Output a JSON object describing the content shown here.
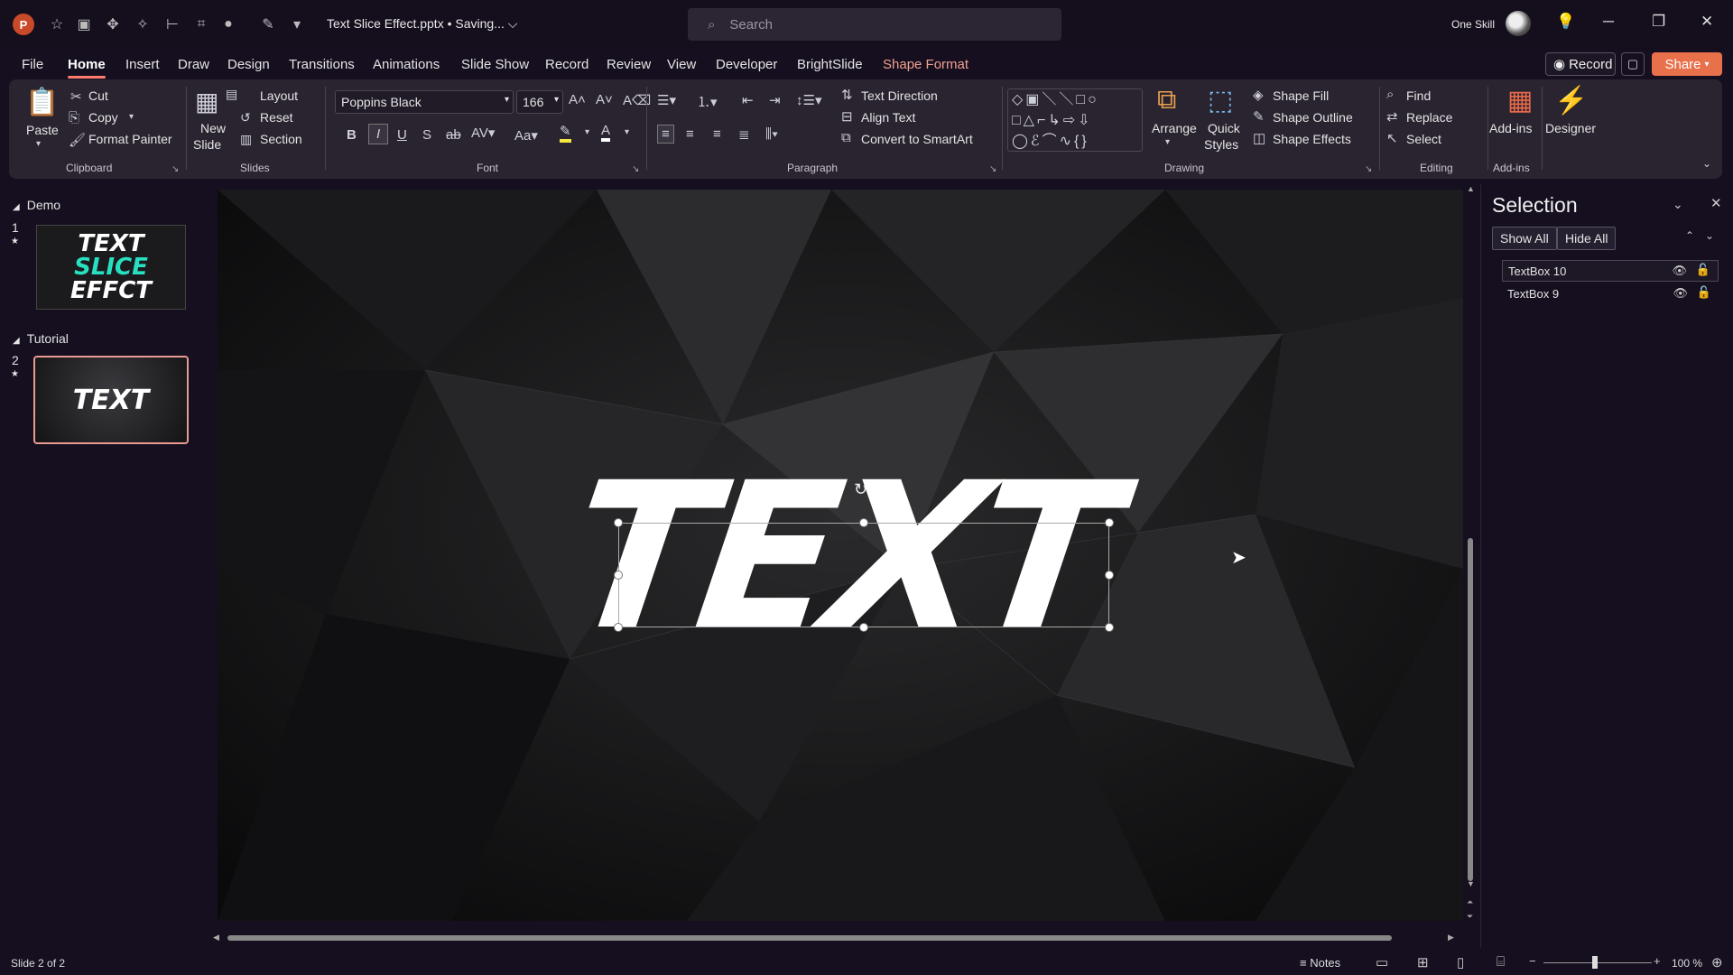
{
  "titlebar": {
    "doc_title": "Text Slice Effect.pptx • Saving... ⌵",
    "search_placeholder": "Search",
    "user_name": "One Skill"
  },
  "menu": {
    "tabs": [
      "File",
      "Home",
      "Insert",
      "Draw",
      "Design",
      "Transitions",
      "Animations",
      "Slide Show",
      "Record",
      "Review",
      "View",
      "Developer",
      "BrightSlide",
      "Shape Format"
    ],
    "active": "Home",
    "record_label": "Record",
    "share_label": "Share"
  },
  "ribbon": {
    "clipboard": {
      "paste": "Paste",
      "cut": "Cut",
      "copy": "Copy",
      "format_painter": "Format Painter",
      "label": "Clipboard"
    },
    "slides": {
      "new_slide_1": "New",
      "new_slide_2": "Slide",
      "layout": "Layout",
      "reset": "Reset",
      "section": "Section",
      "label": "Slides"
    },
    "font": {
      "family": "Poppins Black",
      "size": "166",
      "label": "Font"
    },
    "paragraph": {
      "text_direction": "Text Direction",
      "align_text": "Align Text",
      "convert_smartart": "Convert to SmartArt",
      "label": "Paragraph"
    },
    "drawing": {
      "arrange": "Arrange",
      "quick_styles_1": "Quick",
      "quick_styles_2": "Styles",
      "shape_fill": "Shape Fill",
      "shape_outline": "Shape Outline",
      "shape_effects": "Shape Effects",
      "label": "Drawing"
    },
    "editing": {
      "find": "Find",
      "replace": "Replace",
      "select": "Select",
      "label": "Editing"
    },
    "addins": {
      "addins": "Add-ins",
      "designer": "Designer",
      "label": "Add-ins"
    }
  },
  "left_panel": {
    "sections": [
      "Demo",
      "Tutorial"
    ],
    "slides": [
      {
        "number": "1",
        "lines": [
          "TEXT",
          "SLICE",
          "EFFCT"
        ]
      },
      {
        "number": "2",
        "lines": [
          "TEXT"
        ]
      }
    ]
  },
  "slide": {
    "text": "TEXT"
  },
  "selection_pane": {
    "title": "Selection",
    "show_all": "Show All",
    "hide_all": "Hide All",
    "items": [
      "TextBox 10",
      "TextBox 9"
    ]
  },
  "statusbar": {
    "slide_of": "Slide 2 of 2",
    "notes": "Notes",
    "zoom": "100 %"
  },
  "colors": {
    "accent": "#ff7b6b",
    "shape_format": "#f0a08e",
    "share": "#e8704a",
    "slide_thumb_accent": "#27e0c0"
  }
}
